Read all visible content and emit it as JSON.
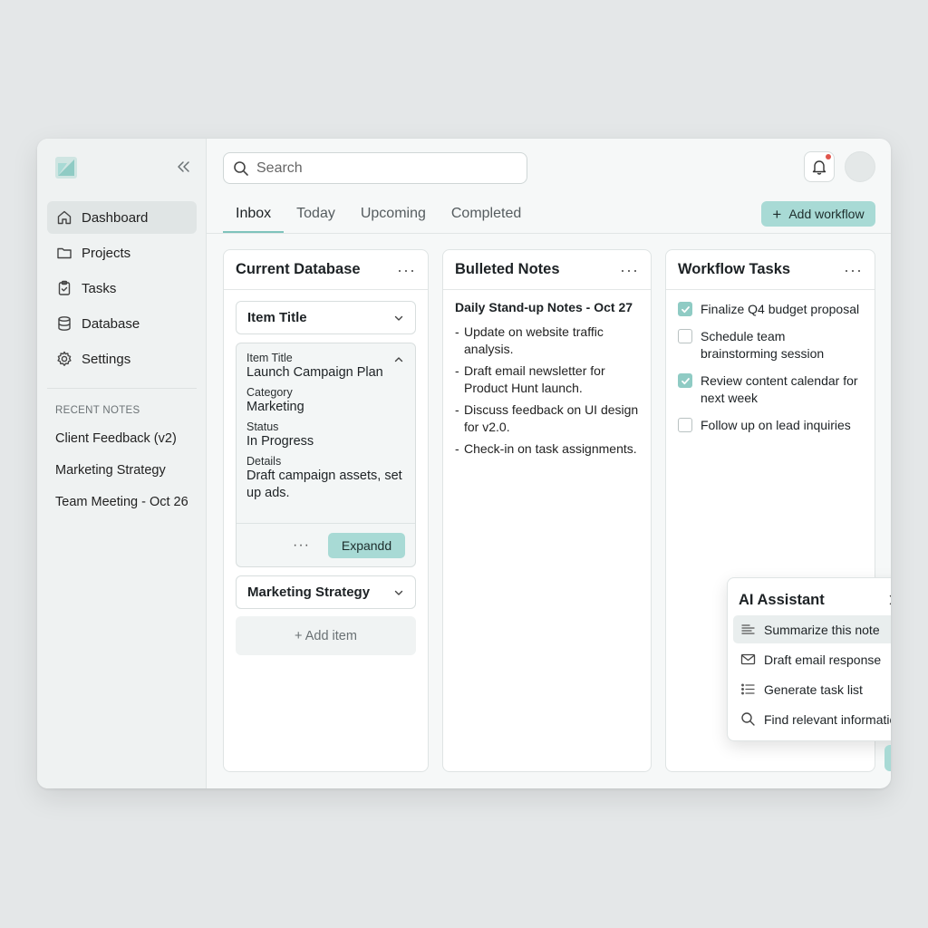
{
  "sidebar": {
    "nav": [
      {
        "label": "Dashboard",
        "icon": "home-icon"
      },
      {
        "label": "Projects",
        "icon": "folder-icon"
      },
      {
        "label": "Tasks",
        "icon": "clipboard-icon"
      },
      {
        "label": "Database",
        "icon": "database-icon"
      },
      {
        "label": "Settings",
        "icon": "gear-icon"
      }
    ],
    "recent_title": "RECENT NOTES",
    "recent": [
      "Client Feedback (v2)",
      "Marketing Strategy",
      "Team Meeting - Oct 26"
    ]
  },
  "header": {
    "search_placeholder": "Search"
  },
  "tabs": [
    "Inbox",
    "Today",
    "Upcoming",
    "Completed"
  ],
  "add_workflow_label": "Add workflow",
  "database": {
    "title": "Current Database",
    "select_label": "Item Title",
    "expanded": {
      "fields": [
        {
          "label": "Item Title",
          "value": "Launch Campaign Plan"
        },
        {
          "label": "Category",
          "value": "Marketing"
        },
        {
          "label": "Status",
          "value": "In Progress"
        },
        {
          "label": "Details",
          "value": "Draft campaign assets, set up ads."
        }
      ],
      "expand_label": "Expandd"
    },
    "second_select_label": "Marketing Strategy",
    "add_item_label": "+ Add item"
  },
  "notes": {
    "title": "Bulleted Notes",
    "heading": "Daily Stand-up Notes - Oct 27",
    "items": [
      "Update on website traffic analysis.",
      "Draft email newsletter for Product Hunt launch.",
      "Discuss feedback on UI design for v2.0.",
      "Check-in on task assignments."
    ]
  },
  "tasks": {
    "title": "Workflow Tasks",
    "items": [
      {
        "label": "Finalize Q4 budget proposal",
        "checked": true
      },
      {
        "label": "Schedule team brainstorming session",
        "checked": false
      },
      {
        "label": "Review content calendar for next week",
        "checked": true
      },
      {
        "label": "Follow up on lead inquiries",
        "checked": false
      }
    ]
  },
  "ai_assistant": {
    "title": "AI Assistant",
    "actions": [
      {
        "label": "Summarize this note",
        "icon": "summary-icon"
      },
      {
        "label": "Draft email response",
        "icon": "mail-icon"
      },
      {
        "label": "Generate task list",
        "icon": "list-icon"
      },
      {
        "label": "Find relevant information",
        "icon": "search-icon"
      }
    ]
  },
  "colors": {
    "accent": "#a8dad5",
    "tab_underline": "#7fc3bc",
    "notification_dot": "#e0554c"
  }
}
